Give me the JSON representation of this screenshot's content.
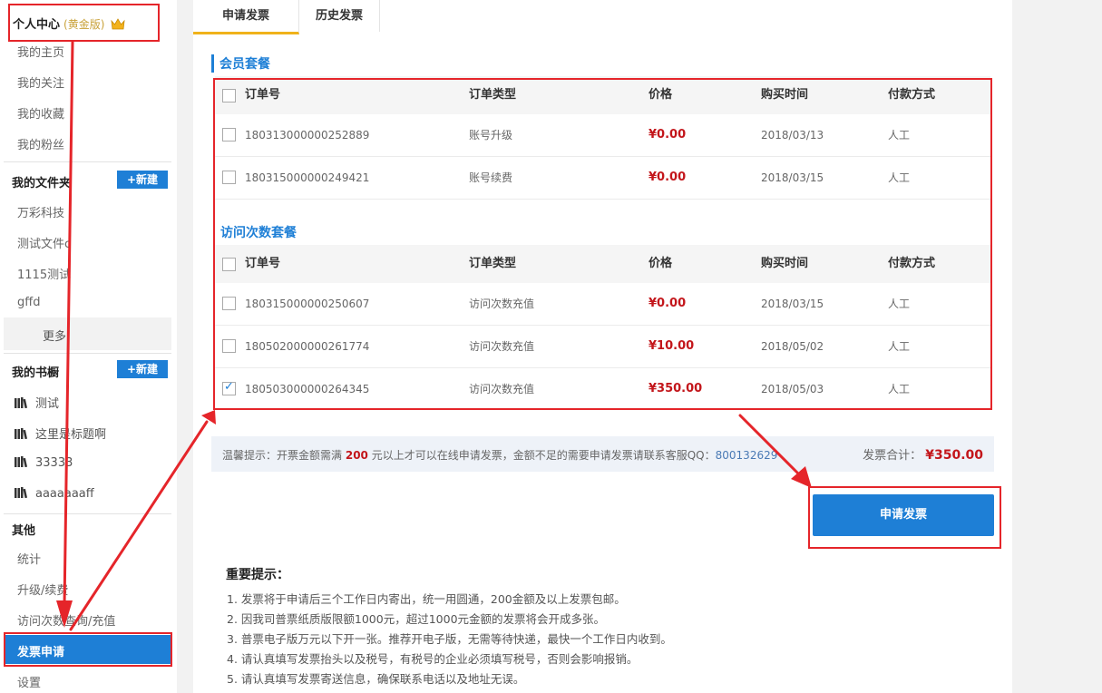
{
  "sidebar": {
    "header": {
      "title": "个人中心",
      "version": "(黄金版)"
    },
    "profile_items": [
      "我的主页",
      "我的关注",
      "我的收藏",
      "我的粉丝"
    ],
    "folders": {
      "title": "我的文件夹",
      "new_label": "+新建",
      "items": [
        "万彩科技",
        "测试文件c",
        "1115测试",
        "gffd"
      ],
      "more_label": "更多"
    },
    "bookshelf": {
      "title": "我的书橱",
      "new_label": "+新建",
      "items": [
        "测试",
        "这里是标题啊",
        "33333",
        "aaaaaaaff"
      ]
    },
    "other": {
      "title": "其他",
      "items": [
        "统计",
        "升级/续费",
        "访问次数查询/充值"
      ],
      "active": "发票申请",
      "settings": "设置"
    }
  },
  "tabs": {
    "apply": "申请发票",
    "history": "历史发票"
  },
  "columns": {
    "order_no": "订单号",
    "order_type": "订单类型",
    "price": "价格",
    "time": "购买时间",
    "payment": "付款方式"
  },
  "membership": {
    "title": "会员套餐",
    "rows": [
      {
        "order_no": "180313000000252889",
        "type": "账号升级",
        "price": "¥0.00",
        "time": "2018/03/13",
        "payment": "人工",
        "checked": false
      },
      {
        "order_no": "180315000000249421",
        "type": "账号续费",
        "price": "¥0.00",
        "time": "2018/03/15",
        "payment": "人工",
        "checked": false
      }
    ]
  },
  "visits": {
    "title": "访问次数套餐",
    "rows": [
      {
        "order_no": "180315000000250607",
        "type": "访问次数充值",
        "price": "¥0.00",
        "time": "2018/03/15",
        "payment": "人工",
        "checked": false
      },
      {
        "order_no": "180502000000261774",
        "type": "访问次数充值",
        "price": "¥10.00",
        "time": "2018/05/02",
        "payment": "人工",
        "checked": false
      },
      {
        "order_no": "180503000000264345",
        "type": "访问次数充值",
        "price": "¥350.00",
        "time": "2018/05/03",
        "payment": "人工",
        "checked": true
      }
    ]
  },
  "notice": {
    "prefix": "温馨提示：开票金额需满",
    "amount": "200",
    "middle": "元以上才可以在线申请发票，金额不足的需要申请发票请联系客服QQ：",
    "qq": "800132629",
    "total_label": "发票合计：",
    "total_value": "¥350.00"
  },
  "apply_button": "申请发票",
  "important": {
    "title": "重要提示：",
    "lines": [
      "1. 发票将于申请后三个工作日内寄出，统一用圆通，200金额及以上发票包邮。",
      "2. 因我司普票纸质版限额1000元，超过1000元金额的发票将会开成多张。",
      "3. 普票电子版万元以下开一张。推荐开电子版，无需等待快递，最快一个工作日内收到。",
      "4. 请认真填写发票抬头以及税号，有税号的企业必须填写税号，否则会影响报销。",
      "5. 请认真填写发票寄送信息，确保联系电话以及地址无误。"
    ]
  },
  "colors": {
    "accent": "#1e7fd6",
    "price": "#c3161b",
    "annotation": "#e5252a",
    "tab_underline": "#f0b21a"
  }
}
